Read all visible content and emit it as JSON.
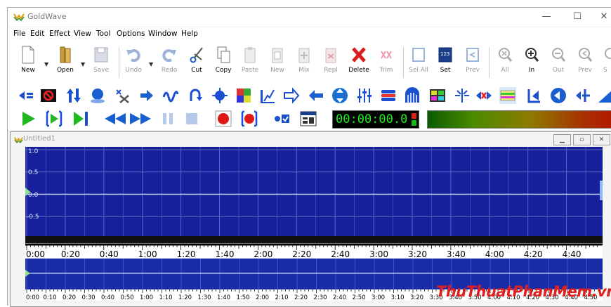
{
  "app": {
    "title": "GoldWave",
    "minimize": "—",
    "maximize": "☐",
    "close": "✕"
  },
  "menu": [
    "File",
    "Edit",
    "Effect",
    "View",
    "Tool",
    "Options",
    "Window",
    "Help"
  ],
  "toolbar": [
    {
      "label": "New",
      "icon": "new-file-icon",
      "enabled": true
    },
    {
      "label": "Open",
      "icon": "open-icon",
      "enabled": true
    },
    {
      "label": "Save",
      "icon": "save-icon",
      "enabled": false
    },
    {
      "label": "Undo",
      "icon": "undo-icon",
      "enabled": false
    },
    {
      "label": "Redo",
      "icon": "redo-icon",
      "enabled": false
    },
    {
      "label": "Cut",
      "icon": "scissors-icon",
      "enabled": true
    },
    {
      "label": "Copy",
      "icon": "copy-icon",
      "enabled": true
    },
    {
      "label": "Paste",
      "icon": "paste-icon",
      "enabled": false
    },
    {
      "label": "New",
      "icon": "paste-new-icon",
      "enabled": false
    },
    {
      "label": "Mix",
      "icon": "mix-icon",
      "enabled": false
    },
    {
      "label": "Repl",
      "icon": "replace-icon",
      "enabled": false
    },
    {
      "label": "Delete",
      "icon": "delete-icon",
      "enabled": true
    },
    {
      "label": "Trim",
      "icon": "trim-icon",
      "enabled": false
    },
    {
      "label": "Sel All",
      "icon": "select-all-icon",
      "enabled": false
    },
    {
      "label": "Set",
      "icon": "set-icon",
      "enabled": true
    },
    {
      "label": "Prev",
      "icon": "previous-selection-icon",
      "enabled": false
    },
    {
      "label": "All",
      "icon": "zoom-all-icon",
      "enabled": false
    },
    {
      "label": "In",
      "icon": "zoom-in-icon",
      "enabled": true
    },
    {
      "label": "Out",
      "icon": "zoom-out-icon",
      "enabled": false
    },
    {
      "label": "Prev",
      "icon": "zoom-previous-icon",
      "enabled": false
    },
    {
      "label": "S",
      "icon": "zoom-selection-icon",
      "enabled": false
    }
  ],
  "effects_toolbar": [
    "balance-icon",
    "dc-offset-icon",
    "volume-change-icon",
    "doppler-icon",
    "noise-reduction-icon",
    "pitch-icon",
    "flanger-icon",
    "echo-icon",
    "equalizer-icon",
    "filter-icon",
    "playback-rate-icon",
    "reverse-icon",
    "shift-icon",
    "fade-in-out-icon",
    "mechanize-icon",
    "compressor-icon",
    "spectrum-filter-icon",
    "channel-mixer-icon",
    "pop-click-icon",
    "reverb-icon",
    "volume-shape-icon",
    "mute-icon",
    "expand-icon",
    "invert-icon",
    "fade-icon"
  ],
  "transport": {
    "time": "00:00:00.0",
    "buttons": [
      "play-icon",
      "play-selection-icon",
      "play-to-end-icon",
      "rewind-icon",
      "fast-forward-icon",
      "pause-icon",
      "stop-icon",
      "record-icon",
      "record-selection-icon",
      "device-controls-icon",
      "control-properties-icon"
    ]
  },
  "document": {
    "title": "Untitled1",
    "buttons": [
      "minimize",
      "restore",
      "close"
    ]
  },
  "waveform": {
    "y_labels": [
      "1.0",
      "0.5",
      "0.0",
      "-0.5"
    ],
    "time_ticks": [
      "0:00",
      "0:20",
      "0:40",
      "1:00",
      "1:20",
      "1:40",
      "2:00",
      "2:20",
      "2:40",
      "3:00",
      "3:20",
      "3:40",
      "4:00",
      "4:20",
      "4:40"
    ]
  },
  "overview": {
    "time_ticks": [
      "0:00",
      "0:10",
      "0:20",
      "0:30",
      "0:40",
      "0:50",
      "1:00",
      "1:10",
      "1:20",
      "1:30",
      "1:40",
      "1:50",
      "2:00",
      "2:10",
      "2:20",
      "2:30",
      "2:40",
      "2:50",
      "3:00",
      "3:10",
      "3:20",
      "3:30",
      "3:40",
      "3:50",
      "4:00",
      "4:10",
      "4:20",
      "4:30",
      "4:40",
      "4:50"
    ]
  },
  "watermark": "ThuThuatPhanMem.vn",
  "colors": {
    "wave_bg": "#15209a",
    "grid": "#5a66c8",
    "zero_line": "#c6d4ff",
    "accent": "#1a5fd0"
  }
}
